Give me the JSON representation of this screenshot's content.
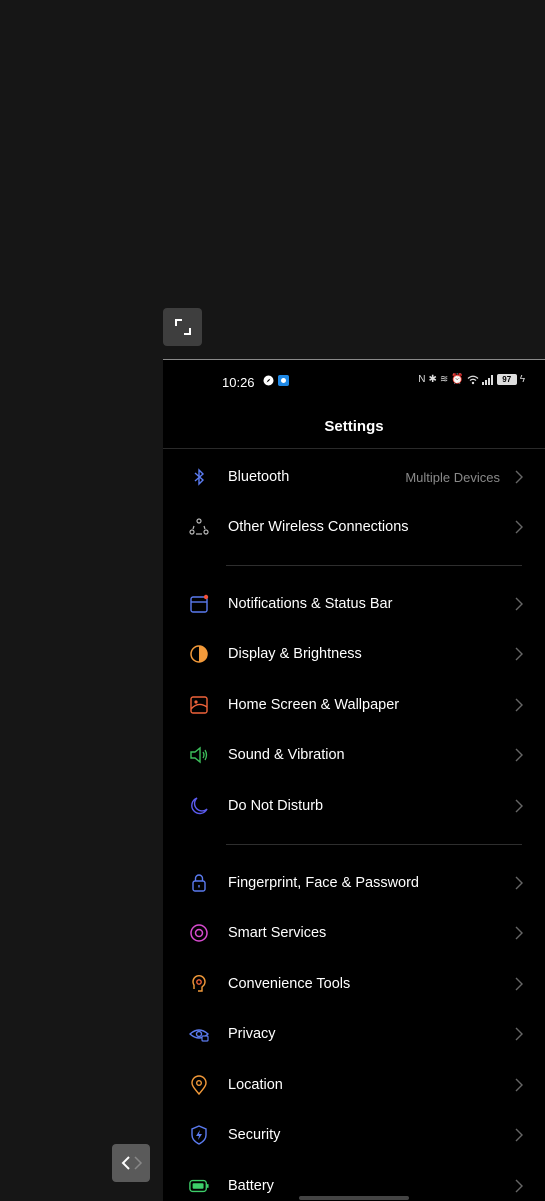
{
  "status_bar": {
    "time": "10:26",
    "battery": "97",
    "left_icons": [
      "compass-icon",
      "app-notification-icon"
    ],
    "right_icons": [
      "nfc-icon",
      "bluetooth-icon",
      "vibrate-icon",
      "alarm-icon",
      "wifi-icon",
      "signal-icon",
      "battery-icon",
      "charging-icon"
    ]
  },
  "header": {
    "title": "Settings"
  },
  "groups": [
    [
      {
        "label": "Bluetooth",
        "value": "Multiple Devices",
        "icon": "bluetooth-icon",
        "color": "#5b7bf0"
      },
      {
        "label": "Other Wireless Connections",
        "value": "",
        "icon": "wireless-connections-icon",
        "color": "#bbbbbb"
      }
    ],
    [
      {
        "label": "Notifications & Status Bar",
        "value": "",
        "icon": "notifications-icon",
        "color": "#5b7bf0"
      },
      {
        "label": "Display & Brightness",
        "value": "",
        "icon": "display-brightness-icon",
        "color": "#f39a3a"
      },
      {
        "label": "Home Screen & Wallpaper",
        "value": "",
        "icon": "wallpaper-icon",
        "color": "#f0633a"
      },
      {
        "label": "Sound & Vibration",
        "value": "",
        "icon": "sound-icon",
        "color": "#3dbf5c"
      },
      {
        "label": "Do Not Disturb",
        "value": "",
        "icon": "moon-icon",
        "color": "#5b5bf0"
      }
    ],
    [
      {
        "label": "Fingerprint, Face & Password",
        "value": "",
        "icon": "lock-icon",
        "color": "#5b7bf0"
      },
      {
        "label": "Smart Services",
        "value": "",
        "icon": "smart-services-icon",
        "color": "#d84bd0"
      },
      {
        "label": "Convenience Tools",
        "value": "",
        "icon": "convenience-tools-icon",
        "color": "#f39a3a"
      },
      {
        "label": "Privacy",
        "value": "",
        "icon": "privacy-icon",
        "color": "#5b7bf0"
      },
      {
        "label": "Location",
        "value": "",
        "icon": "location-icon",
        "color": "#f39a3a"
      },
      {
        "label": "Security",
        "value": "",
        "icon": "security-icon",
        "color": "#5b7bf0"
      },
      {
        "label": "Battery",
        "value": "",
        "icon": "battery-icon",
        "color": "#3dcf6a"
      }
    ]
  ]
}
